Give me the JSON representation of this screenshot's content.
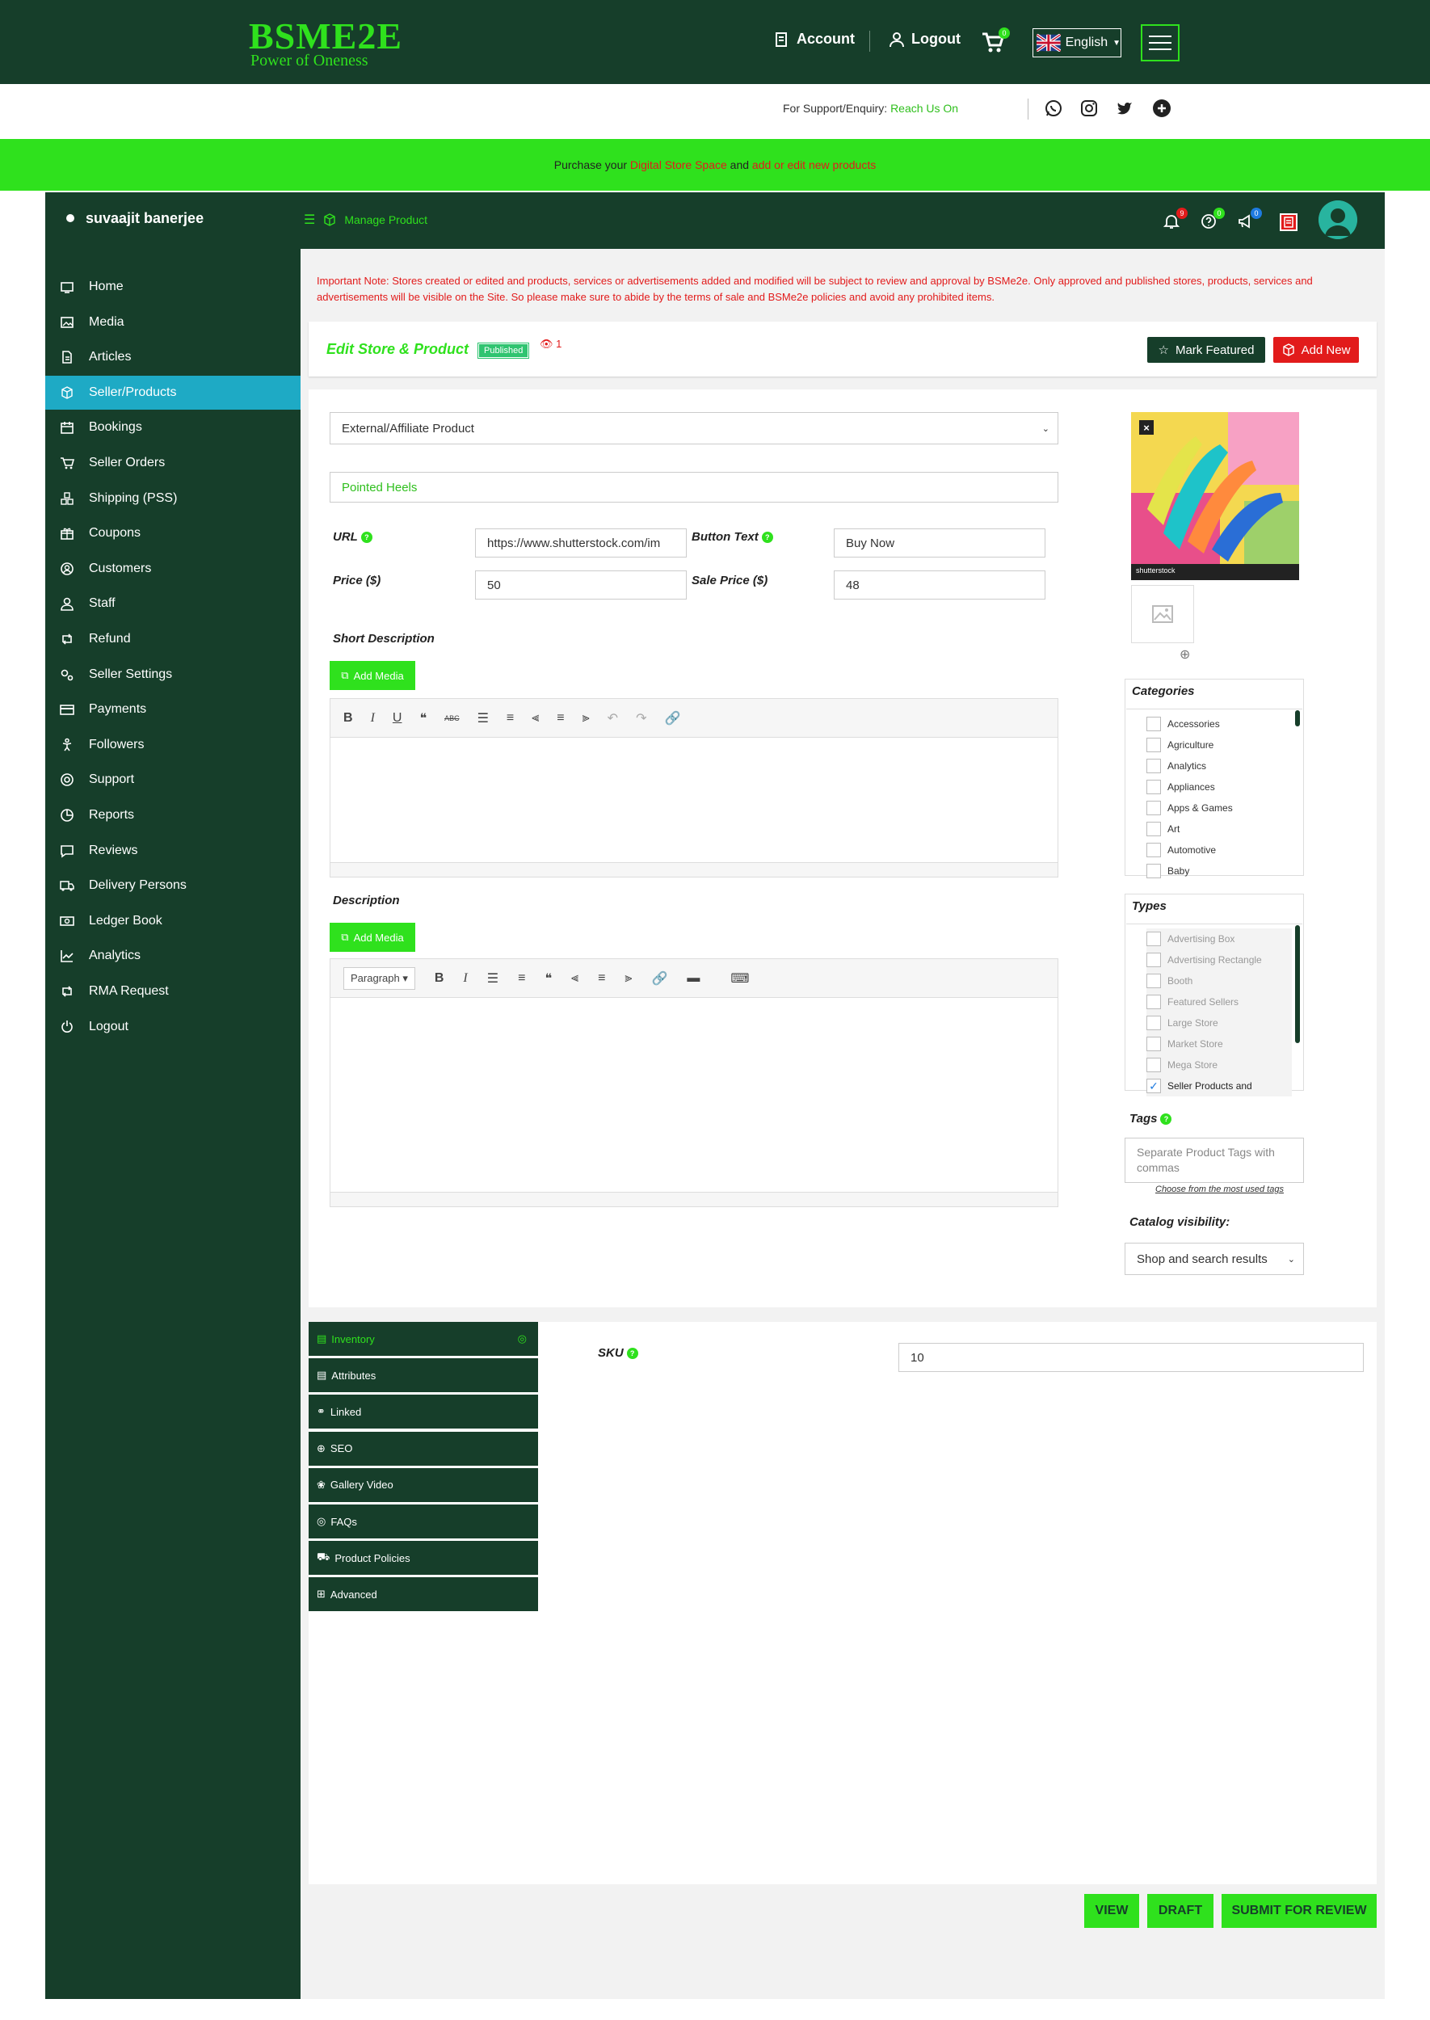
{
  "header": {
    "logo_main": "BSME2E",
    "logo_sub": "Power of Oneness",
    "account_label": "Account",
    "logout_label": "Logout",
    "cart_count": "0",
    "language": "English"
  },
  "support": {
    "prefix": "For Support/Enquiry:",
    "link": "Reach Us On"
  },
  "promo": {
    "t1": "Purchase your ",
    "link1": "Digital Store Space",
    "t2": " and ",
    "link2": "add or edit new products"
  },
  "sidebar": {
    "user_name": "suvaajit banerjee",
    "items": [
      {
        "label": "Home",
        "icon": "home-icon"
      },
      {
        "label": "Media",
        "icon": "image-icon"
      },
      {
        "label": "Articles",
        "icon": "file-icon"
      },
      {
        "label": "Seller/Products",
        "icon": "cube-icon",
        "active": true
      },
      {
        "label": "Bookings",
        "icon": "calendar-icon"
      },
      {
        "label": "Seller Orders",
        "icon": "cart-icon"
      },
      {
        "label": "Shipping (PSS)",
        "icon": "cubes-icon"
      },
      {
        "label": "Coupons",
        "icon": "gift-icon"
      },
      {
        "label": "Customers",
        "icon": "user-circle-icon"
      },
      {
        "label": "Staff",
        "icon": "user-icon"
      },
      {
        "label": "Refund",
        "icon": "retweet-icon"
      },
      {
        "label": "Seller Settings",
        "icon": "cogs-icon"
      },
      {
        "label": "Payments",
        "icon": "card-icon"
      },
      {
        "label": "Followers",
        "icon": "child-icon"
      },
      {
        "label": "Support",
        "icon": "lifebuoy-icon"
      },
      {
        "label": "Reports",
        "icon": "chart-pie-icon"
      },
      {
        "label": "Reviews",
        "icon": "comment-icon"
      },
      {
        "label": "Delivery Persons",
        "icon": "truck-icon"
      },
      {
        "label": "Ledger Book",
        "icon": "money-icon"
      },
      {
        "label": "Analytics",
        "icon": "line-chart-icon"
      },
      {
        "label": "RMA Request",
        "icon": "retweet-icon"
      },
      {
        "label": "Logout",
        "icon": "power-icon"
      }
    ]
  },
  "panel": {
    "breadcrumb": "Manage Product",
    "notif_count": "9",
    "help_count": "0",
    "announce_count": "0"
  },
  "note": "Important Note: Stores created or edited and products, services or advertisements added and modified will be subject to review and approval by BSMe2e. Only approved and published stores, products, services and advertisements will be visible on the Site. So please make sure to abide by the terms of sale and BSMe2e policies and avoid any prohibited items.",
  "title": {
    "text": "Edit Store & Product",
    "status": "Published",
    "views": "1",
    "mark_featured": "Mark Featured",
    "add_new": "Add New"
  },
  "form": {
    "product_type": "External/Affiliate Product",
    "product_name": "Pointed Heels",
    "url_label": "URL",
    "url_value": "https://www.shutterstock.com/im",
    "button_text_label": "Button Text",
    "button_text_value": "Buy Now",
    "price_label": "Price ($)",
    "price_value": "50",
    "sale_price_label": "Sale Price ($)",
    "sale_price_value": "48",
    "short_desc_label": "Short Description",
    "desc_label": "Description",
    "add_media": "Add Media",
    "paragraph": "Paragraph"
  },
  "categories": {
    "title": "Categories",
    "items": [
      "Accessories",
      "Agriculture",
      "Analytics",
      "Appliances",
      "Apps & Games",
      "Art",
      "Automotive",
      "Baby"
    ]
  },
  "types": {
    "title": "Types",
    "items": [
      "Advertising Box",
      "Advertising Rectangle",
      "Booth",
      "Featured Sellers",
      "Large Store",
      "Market Store",
      "Mega Store",
      "Seller Products and"
    ]
  },
  "tags": {
    "label": "Tags",
    "placeholder": "Separate Product Tags with commas",
    "choose": "Choose from the most used tags"
  },
  "catalog": {
    "label": "Catalog visibility:",
    "value": "Shop and search results"
  },
  "image": {
    "watermark": "shutterstock"
  },
  "tabs": [
    "Inventory",
    "Attributes",
    "Linked",
    "SEO",
    "Gallery Video",
    "FAQs",
    "Product Policies",
    "Advanced"
  ],
  "inventory": {
    "sku_label": "SKU",
    "sku_value": "10"
  },
  "actions": {
    "view": "VIEW",
    "draft": "DRAFT",
    "submit": "SUBMIT FOR REVIEW"
  },
  "colors": {
    "dark_green": "#163e2a",
    "accent_green": "#2fe11d",
    "active_blue": "#1eaac5",
    "alert_red": "#e21b1b"
  }
}
